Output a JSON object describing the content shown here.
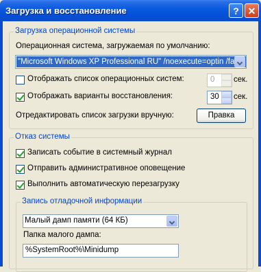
{
  "window": {
    "title": "Загрузка и восстановление",
    "help_label": "?",
    "close_label": "✕"
  },
  "boot": {
    "group_title": "Загрузка операционной системы",
    "default_os_label": "Операционная система, загружаемая по умолчанию:",
    "default_os_value": "\"Microsoft Windows XP Professional RU\" /noexecute=optin /fastd",
    "show_os_list_label": "Отображать список операционных систем:",
    "show_os_list_checked": false,
    "show_os_list_value": "0",
    "show_recovery_label": "Отображать варианты восстановления:",
    "show_recovery_checked": true,
    "show_recovery_value": "30",
    "seconds_unit": "сек.",
    "edit_manual_label": "Отредактировать список загрузки вручную:",
    "edit_button_label": "Правка"
  },
  "failure": {
    "group_title": "Отказ системы",
    "write_event_label": "Записать событие в системный журнал",
    "send_alert_label": "Отправить административное оповещение",
    "auto_restart_label": "Выполнить автоматическую перезагрузку"
  },
  "debug": {
    "group_title": "Запись отладочной информации",
    "dump_type_value": "Малый дамп памяти (64 КБ)",
    "dump_folder_label": "Папка малого дампа:",
    "dump_folder_value": "%SystemRoot%\\Minidump"
  }
}
